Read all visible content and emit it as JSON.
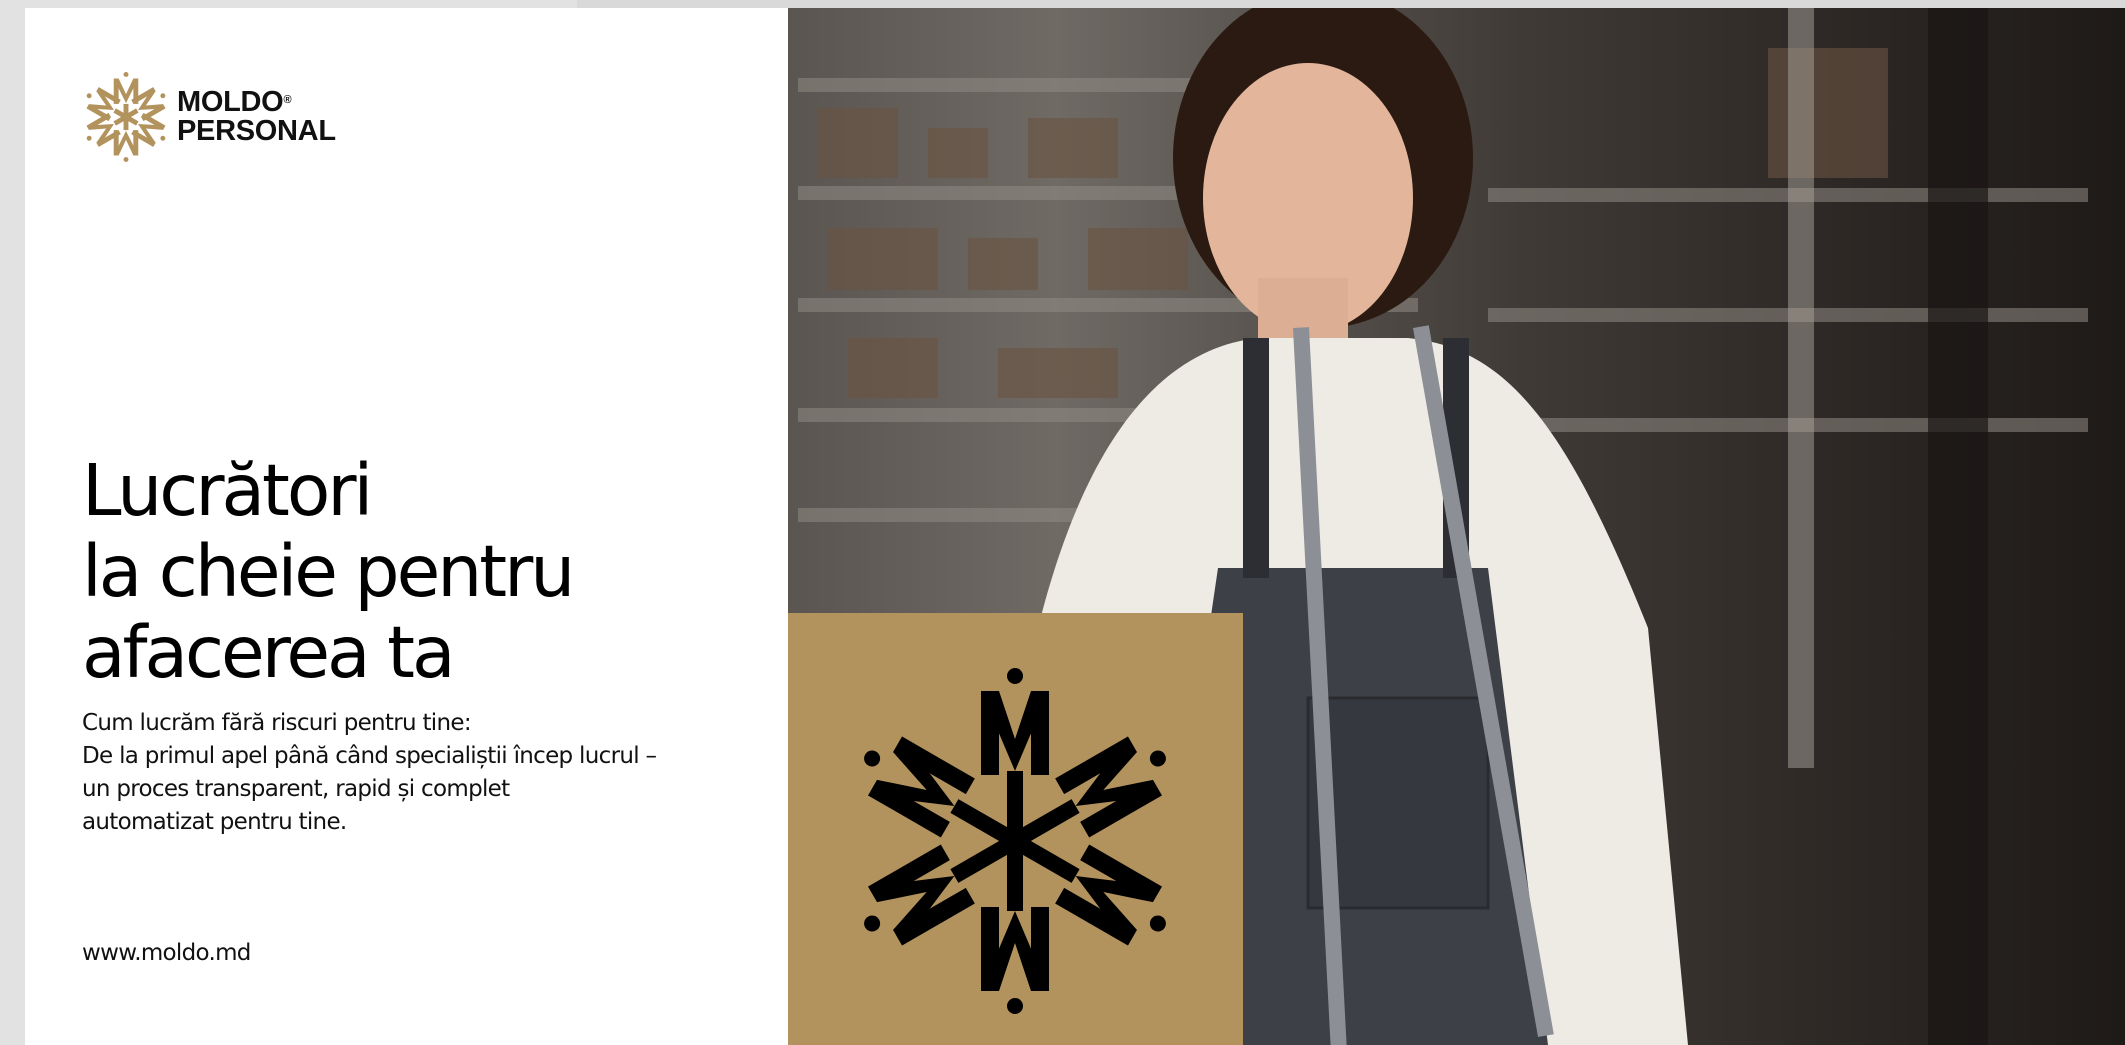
{
  "brand": {
    "name_line1": "MOLDO",
    "registered": "®",
    "name_line2": "PERSONAL",
    "accent_color": "#b3935d"
  },
  "hero": {
    "headline_lines": [
      "Lucrători",
      "la cheie pentru",
      "afacerea ta"
    ],
    "subtitle_lines": [
      "Cum lucrăm fără riscuri pentru tine:",
      "De la primul apel până când specialiștii încep lucrul –",
      "un proces transparent, rapid și complet",
      "automatizat pentru tine."
    ]
  },
  "footer": {
    "website": "www.moldo.md"
  },
  "icons": {
    "logo_mark": "snowflake-monogram-icon",
    "emblem": "snowflake-monogram-emblem"
  }
}
